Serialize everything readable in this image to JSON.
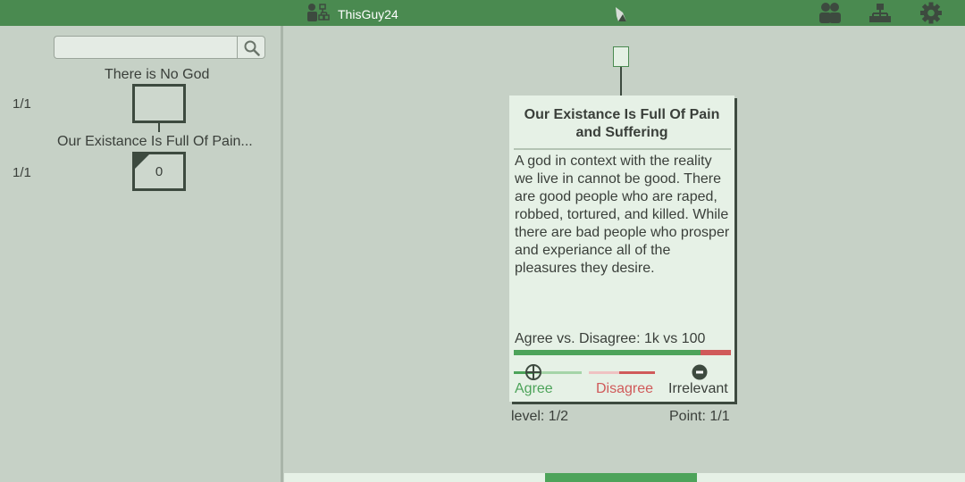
{
  "header": {
    "username": "ThisGuy24",
    "icons": [
      "users-tree-icon",
      "bird-logo",
      "users-icon",
      "hierarchy-icon",
      "gear-icon"
    ]
  },
  "sidebar": {
    "search": {
      "placeholder": "",
      "value": ""
    },
    "tree": [
      {
        "title": "There is No God",
        "count": "1/1",
        "value": ""
      },
      {
        "title": "Our Existance Is Full Of Pain...",
        "count": "1/1",
        "value": "0"
      }
    ]
  },
  "card": {
    "title": "Our Existance Is Full Of Pain and Suffering",
    "body": "A god in context with the reality we live in cannot be good. There are good people who are raped, robbed, tortured, and killed. While there are bad people who prosper and experiance all of the pleasures they desire.",
    "vote_summary": "Agree vs. Disagree: 1k vs 100",
    "agree_fraction": 0.86,
    "agree_label": "Agree",
    "disagree_label": "Disagree",
    "irrelevant_label": "Irrelevant"
  },
  "footer": {
    "level": "level: 1/2",
    "point": "Point: 1/1"
  },
  "colors": {
    "header": "#4a8a50",
    "agree": "#4da35a",
    "disagree": "#d05a5a",
    "background": "#c6d1c6",
    "card": "#e6f1e6"
  }
}
